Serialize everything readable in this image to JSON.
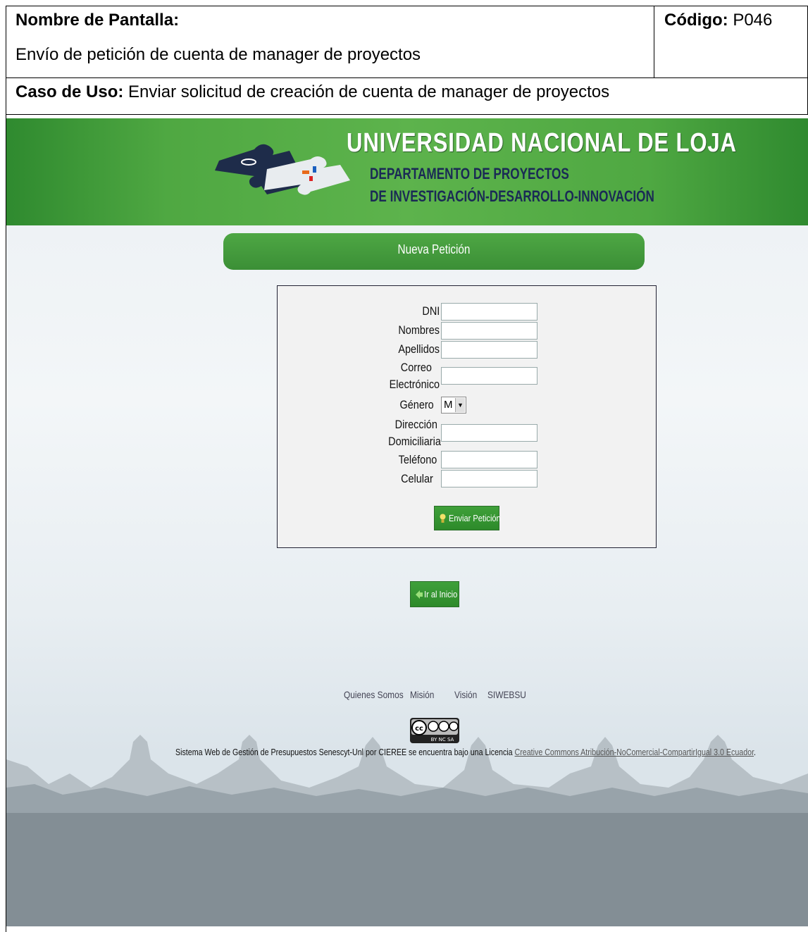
{
  "doc_header": {
    "screen_name_label": "Nombre de Pantalla:",
    "screen_name_value": "Envío de petición de cuenta de manager de proyectos",
    "code_label": "Código:",
    "code_value": "P046",
    "use_case_label": "Caso de Uso:",
    "use_case_value": "Enviar solicitud de creación de cuenta de manager de proyectos"
  },
  "banner": {
    "title": "UNIVERSIDAD  NACIONAL  DE  LOJA",
    "dept_line1": "DEPARTAMENTO DE PROYECTOS",
    "dept_line2": "DE INVESTIGACIÓN-DESARROLLO-INNOVACIÓN",
    "logo_icon": "puzzle-pieces-logo"
  },
  "section_title": "Nueva Petición",
  "form": {
    "fields": [
      {
        "label": "DNI",
        "value": ""
      },
      {
        "label": "Nombres",
        "value": ""
      },
      {
        "label": "Apellidos",
        "value": ""
      },
      {
        "label_line1": "Correo",
        "label_line2": "Electrónico",
        "value": ""
      },
      {
        "label": "Género",
        "selected": "M"
      },
      {
        "label_line1": "Dirección",
        "label_line2": "Domiciliaria",
        "value": ""
      },
      {
        "label": "Teléfono",
        "value": ""
      },
      {
        "label": "Celular",
        "value": ""
      }
    ],
    "submit_label": "Enviar Petición",
    "submit_icon": "lightbulb-icon"
  },
  "home_button": {
    "label": "Ir al Inicio",
    "icon": "back-arrow-icon"
  },
  "footer": {
    "links": [
      "Quienes Somos",
      "Misión",
      "Visión",
      "SIWEBSU"
    ],
    "cc_badge": "cc by-nc-sa",
    "license_text": "Sistema Web de Gestión de Presupuestos Senescyt-Unl por CIEREE se encuentra bajo una Licencia",
    "license_link": "Creative Commons Atribución-NoComercial-CompartirIgual 3.0 Ecuador",
    "license_end": "."
  },
  "colors": {
    "banner_green": "#4fa842",
    "button_green": "#2d8a2a",
    "title_navy": "#1a2a55",
    "ground_gray": "#838e95"
  }
}
